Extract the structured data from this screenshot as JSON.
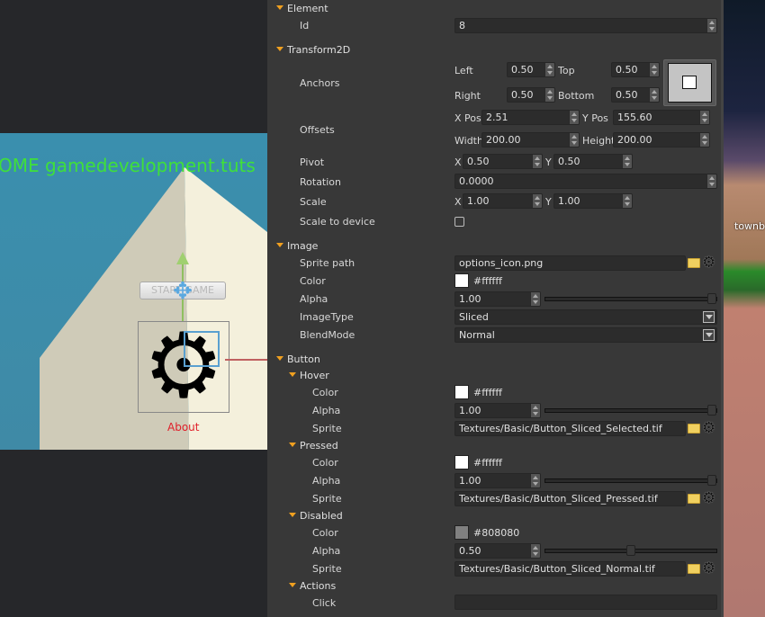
{
  "viewport": {
    "welcome_text": "OME gamedevelopment.tuts",
    "start_button": "START GAME",
    "about_label": "About"
  },
  "right_viewport": {
    "label": "townb"
  },
  "inspector": {
    "element": {
      "title": "Element",
      "id_label": "Id",
      "id_value": "8"
    },
    "transform": {
      "title": "Transform2D",
      "anchors_label": "Anchors",
      "left_label": "Left",
      "left": "0.50",
      "top_label": "Top",
      "top": "0.50",
      "right_label": "Right",
      "right": "0.50",
      "bottom_label": "Bottom",
      "bottom": "0.50",
      "offsets_label": "Offsets",
      "xpos_label": "X Pos",
      "xpos": "2.51",
      "ypos_label": "Y Pos",
      "ypos": "155.60",
      "width_label": "Width",
      "width": "200.00",
      "height_label": "Height",
      "height": "200.00",
      "pivot_label": "Pivot",
      "pivot_x_label": "X",
      "pivot_x": "0.50",
      "pivot_y_label": "Y",
      "pivot_y": "0.50",
      "rotation_label": "Rotation",
      "rotation": "0.0000",
      "scale_label": "Scale",
      "scale_x_label": "X",
      "scale_x": "1.00",
      "scale_y_label": "Y",
      "scale_y": "1.00",
      "scale_to_device_label": "Scale to device",
      "scale_to_device": false
    },
    "image": {
      "title": "Image",
      "sprite_path_label": "Sprite path",
      "sprite_path": "options_icon.png",
      "color_label": "Color",
      "color": "#ffffff",
      "alpha_label": "Alpha",
      "alpha": "1.00",
      "alpha_fraction": 1.0,
      "image_type_label": "ImageType",
      "image_type": "Sliced",
      "blend_mode_label": "BlendMode",
      "blend_mode": "Normal"
    },
    "button": {
      "title": "Button",
      "hover": {
        "title": "Hover",
        "color_label": "Color",
        "color": "#ffffff",
        "alpha_label": "Alpha",
        "alpha": "1.00",
        "alpha_fraction": 1.0,
        "sprite_label": "Sprite",
        "sprite": "Textures/Basic/Button_Sliced_Selected.tif"
      },
      "pressed": {
        "title": "Pressed",
        "color_label": "Color",
        "color": "#ffffff",
        "alpha_label": "Alpha",
        "alpha": "1.00",
        "alpha_fraction": 1.0,
        "sprite_label": "Sprite",
        "sprite": "Textures/Basic/Button_Sliced_Pressed.tif"
      },
      "disabled": {
        "title": "Disabled",
        "color_label": "Color",
        "color": "#808080",
        "alpha_label": "Alpha",
        "alpha": "0.50",
        "alpha_fraction": 0.5,
        "sprite_label": "Sprite",
        "sprite": "Textures/Basic/Button_Sliced_Normal.tif"
      },
      "actions": {
        "title": "Actions",
        "click_label": "Click",
        "click": ""
      }
    }
  },
  "colors": {
    "accent": "#f0a020",
    "panel": "#383838"
  }
}
